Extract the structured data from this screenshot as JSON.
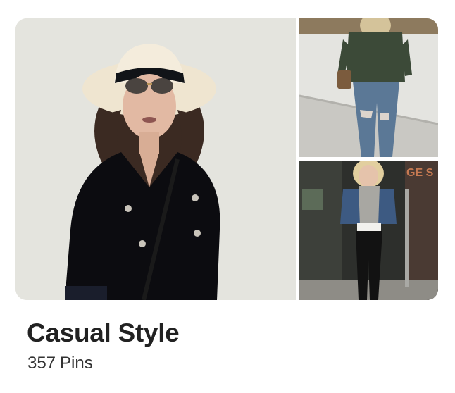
{
  "board": {
    "title": "Casual Style",
    "pin_count": "357",
    "pin_label": "Pins"
  },
  "images": {
    "main": "woman-in-white-fedora-black-blazer",
    "top_right": "woman-in-green-blouse-ripped-jeans",
    "bottom_right": "woman-in-denim-jacket-black-leggings"
  },
  "colors": {
    "title": "#222222",
    "subtitle": "#333333",
    "background": "#ffffff"
  }
}
